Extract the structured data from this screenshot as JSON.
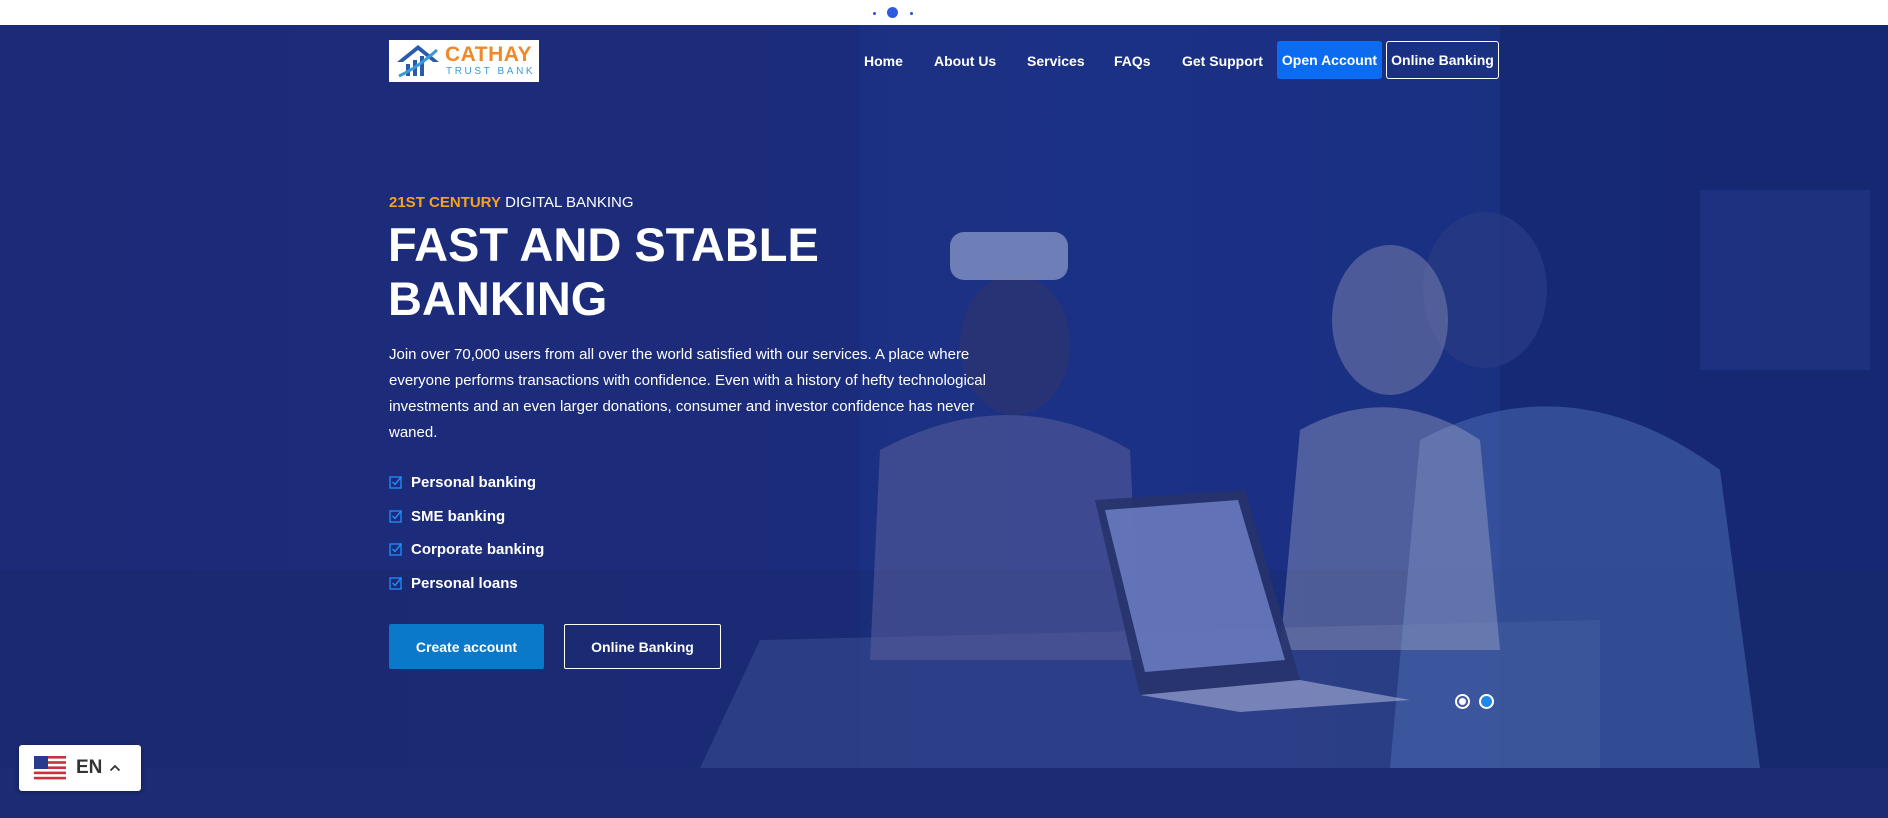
{
  "top_strip": {
    "indicator": "loading-dots"
  },
  "brand": {
    "name_line1": "CATHAY",
    "name_line2": "TRUST BANK",
    "color_orange": "#f0892a",
    "color_blue": "#3a9ad8"
  },
  "nav": {
    "items": [
      {
        "label": "Home"
      },
      {
        "label": "About Us"
      },
      {
        "label": "Services"
      },
      {
        "label": "FAQs"
      },
      {
        "label": "Get Support"
      }
    ],
    "open_account_label": "Open Account",
    "online_banking_label": "Online Banking"
  },
  "hero": {
    "eyebrow_accent": "21ST CENTURY",
    "eyebrow_rest": " DIGITAL BANKING",
    "headline_line1": "FAST AND STABLE",
    "headline_line2": "BANKING",
    "description": "Join over 70,000 users from all over the world satisfied with our services. A place where everyone performs transactions with confidence. Even with a history of hefty technological investments and an even larger donations, consumer and investor confidence has never waned.",
    "features": [
      {
        "label": "Personal banking"
      },
      {
        "label": "SME banking"
      },
      {
        "label": "Corporate banking"
      },
      {
        "label": "Personal loans"
      }
    ],
    "create_account_label": "Create account",
    "online_banking_label": "Online Banking",
    "slider": {
      "total": 2,
      "active_index": 2
    }
  },
  "language": {
    "code": "EN",
    "flag_icon": "us-flag-icon",
    "chevron_icon": "chevron-up-icon"
  },
  "colors": {
    "hero_overlay": "#1c2b78",
    "accent_orange": "#f7a21b",
    "primary_button": "#0b6cf2",
    "create_button": "#0a79c9",
    "check_icon": "#1e90ff"
  }
}
